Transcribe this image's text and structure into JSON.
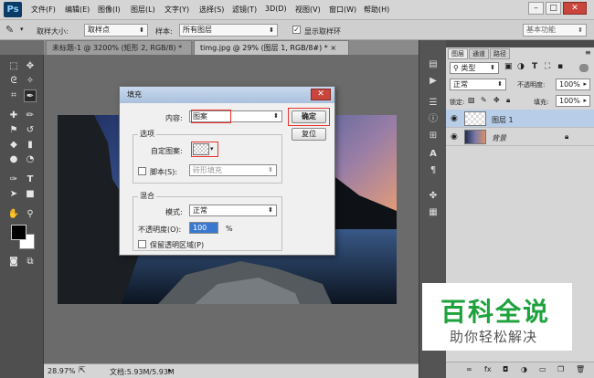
{
  "app": {
    "logo": "Ps"
  },
  "menu": [
    "文件(F)",
    "编辑(E)",
    "图像(I)",
    "图层(L)",
    "文字(Y)",
    "选择(S)",
    "滤镜(T)",
    "3D(D)",
    "视图(V)",
    "窗口(W)",
    "帮助(H)"
  ],
  "window_buttons": {
    "minimize": "–",
    "restore": "□",
    "close": "✕"
  },
  "options_bar": {
    "sample_size_label": "取样大小:",
    "sample_size_value": "取样点",
    "sample_label": "样本:",
    "sample_value": "所有图层",
    "show_ring_label": "显示取样环",
    "workspace": "基本功能"
  },
  "doc_tabs": [
    {
      "label": "未标题-1 @ 3200% (矩形 2, RGB/8) *",
      "close": "×"
    },
    {
      "label": "timg.jpg @ 29% (图层 1, RGB/8#) *",
      "close": "×"
    }
  ],
  "status": {
    "zoom": "28.97%",
    "doc": "文档:5.93M/5.93M"
  },
  "layers_panel": {
    "tabs": [
      "图层",
      "通道",
      "路径"
    ],
    "filter_kind": "类型",
    "blend_mode": "正常",
    "opacity_label": "不透明度:",
    "opacity_value": "100%",
    "lock_label": "锁定:",
    "fill_label": "填充:",
    "fill_value": "100%",
    "layers": [
      {
        "name": "图层 1"
      },
      {
        "name": "背景"
      }
    ]
  },
  "dialog": {
    "title": "填充",
    "close": "✕",
    "contents_label": "内容:",
    "contents_value": "图案",
    "ok": "确定",
    "reset": "复位",
    "options_group": "选项",
    "custom_pattern_label": "自定图案:",
    "script_label": "脚本(S):",
    "script_value": "砖形填充",
    "blending_group": "混合",
    "mode_label": "模式:",
    "mode_value": "正常",
    "opacity_label": "不透明度(O):",
    "opacity_value": "100",
    "opacity_unit": "%",
    "preserve_label": "保留透明区域(P)"
  },
  "watermark": {
    "title": "百科全说",
    "subtitle": "助你轻松解决"
  },
  "colors": {
    "accent_red": "#e8322e",
    "watermark_green": "#1ea23c",
    "selection_blue": "#b8cde8"
  }
}
